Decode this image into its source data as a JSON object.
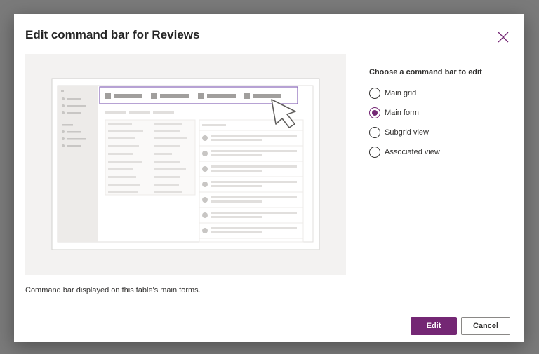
{
  "dialog": {
    "title": "Edit command bar for Reviews",
    "caption": "Command bar displayed on this table's main forms.",
    "close_icon": "close-icon"
  },
  "options": {
    "heading": "Choose a command bar to edit",
    "items": [
      {
        "label": "Main grid",
        "checked": false
      },
      {
        "label": "Main form",
        "checked": true
      },
      {
        "label": "Subgrid view",
        "checked": false
      },
      {
        "label": "Associated view",
        "checked": false
      }
    ]
  },
  "buttons": {
    "edit_label": "Edit",
    "cancel_label": "Cancel"
  },
  "colors": {
    "accent": "#742774",
    "preview_bg": "#f3f2f1"
  }
}
